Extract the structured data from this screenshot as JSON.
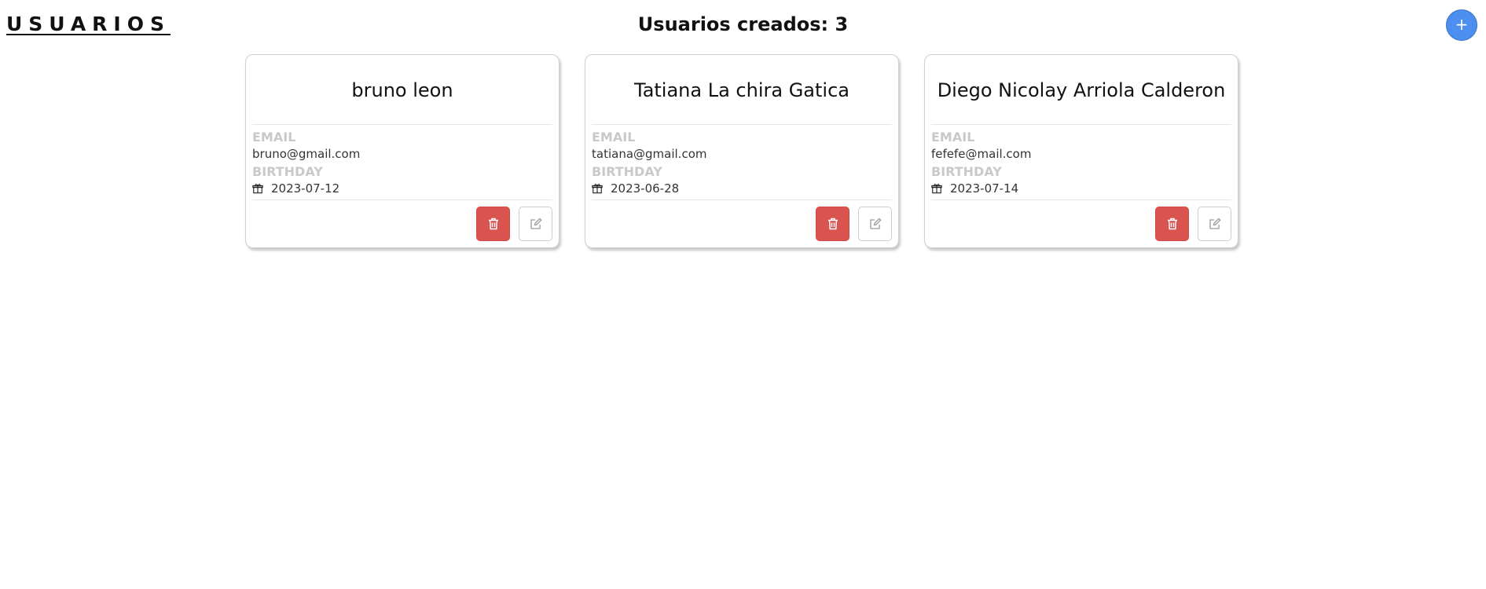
{
  "header": {
    "title": "USUARIOS",
    "count_text": "Usuarios creados: 3",
    "add_button_label": "+"
  },
  "labels": {
    "email": "EMAIL",
    "birthday": "BIRTHDAY"
  },
  "users": [
    {
      "name": "bruno leon",
      "email": "bruno@gmail.com",
      "birthday": "2023-07-12"
    },
    {
      "name": "Tatiana La chira Gatica",
      "email": "tatiana@gmail.com",
      "birthday": "2023-06-28"
    },
    {
      "name": "Diego Nicolay Arriola Calderon",
      "email": "fefefe@mail.com",
      "birthday": "2023-07-14"
    }
  ],
  "icons": {
    "delete": "trash-icon",
    "edit": "edit-icon",
    "birthday": "gift-icon"
  },
  "colors": {
    "accent": "#4c8ff0",
    "danger": "#d9534f",
    "label": "#c9c9c9"
  }
}
